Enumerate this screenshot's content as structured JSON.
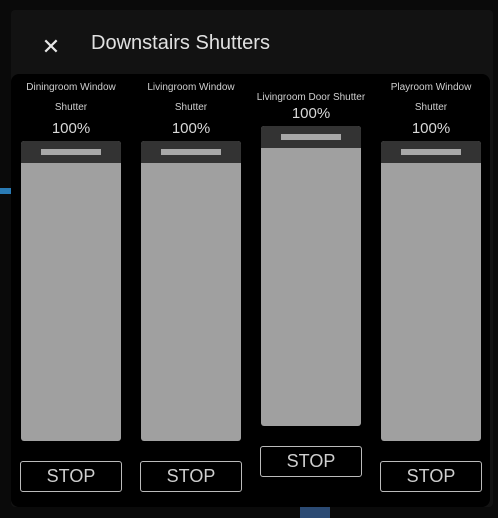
{
  "dialog": {
    "title": "Downstairs Shutters",
    "close_icon": "close-icon"
  },
  "shutters": [
    {
      "name": "Diningroom Window Shutter",
      "position": "100%",
      "level": 100,
      "stop_label": "STOP"
    },
    {
      "name": "Livingroom Window Shutter",
      "position": "100%",
      "level": 100,
      "stop_label": "STOP"
    },
    {
      "name": "Livingroom Door Shutter",
      "position": "100%",
      "level": 100,
      "stop_label": "STOP"
    },
    {
      "name": "Playroom Window Shutter",
      "position": "100%",
      "level": 100,
      "stop_label": "STOP"
    }
  ]
}
